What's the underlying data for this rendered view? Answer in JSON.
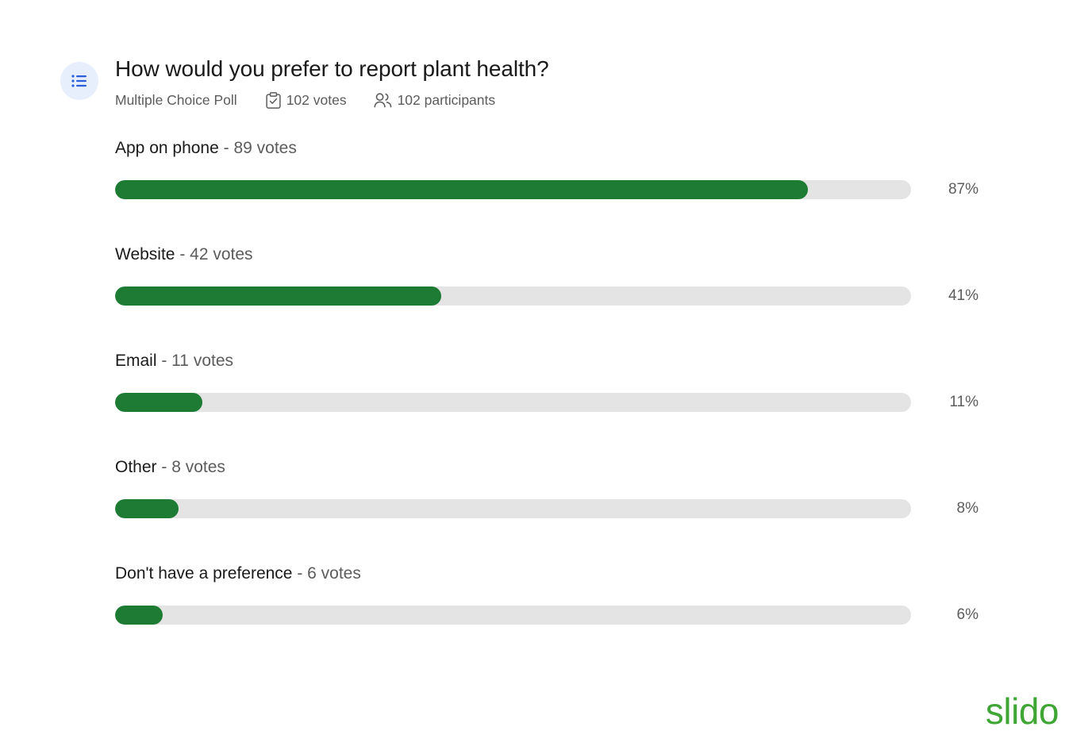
{
  "poll": {
    "icon": "list-icon",
    "title": "How would you prefer to report plant health?",
    "type_label": "Multiple Choice Poll",
    "votes_label": "102 votes",
    "participants_label": "102 participants",
    "votes_icon": "clipboard-check-icon",
    "participants_icon": "people-icon"
  },
  "branding": {
    "logo_text": "slido"
  },
  "colors": {
    "bar_fill": "#1e7b33",
    "bar_track": "#e4e4e4",
    "icon_badge_bg": "#e8effc",
    "icon_badge_fg": "#2b5fd9",
    "logo": "#3fa535",
    "title": "#1a1a1a",
    "muted_text": "#5c5c5c"
  },
  "chart_data": {
    "type": "bar",
    "title": "How would you prefer to report plant health?",
    "subtitle": "Multiple Choice Poll",
    "orientation": "horizontal",
    "xlabel": "",
    "ylabel": "",
    "xlim": [
      0,
      100
    ],
    "grid": false,
    "legend": "none",
    "total_votes": 102,
    "total_participants": 102,
    "categories": [
      "App on phone",
      "Website",
      "Email",
      "Other",
      "Don't have a preference"
    ],
    "values": [
      89,
      42,
      11,
      8,
      6
    ],
    "percentages": [
      87,
      41,
      11,
      8,
      6
    ],
    "options": [
      {
        "label": "App on phone",
        "votes": 89,
        "votes_text": "- 89 votes",
        "percent": 87,
        "percent_text": "87%"
      },
      {
        "label": "Website",
        "votes": 42,
        "votes_text": "- 42 votes",
        "percent": 41,
        "percent_text": "41%"
      },
      {
        "label": "Email",
        "votes": 11,
        "votes_text": "- 11 votes",
        "percent": 11,
        "percent_text": "11%"
      },
      {
        "label": "Other",
        "votes": 8,
        "votes_text": "- 8 votes",
        "percent": 8,
        "percent_text": "8%"
      },
      {
        "label": "Don't have a preference",
        "votes": 6,
        "votes_text": "- 6 votes",
        "percent": 6,
        "percent_text": "6%"
      }
    ]
  }
}
